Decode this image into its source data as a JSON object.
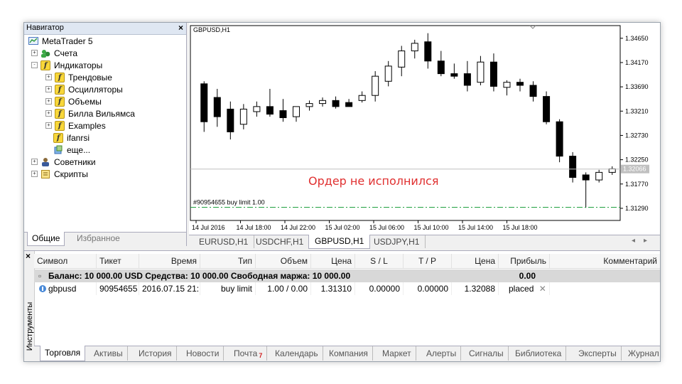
{
  "navigator": {
    "title": "Навигатор",
    "items": [
      {
        "label": "MetaTrader 5",
        "icon": "metatrader-icon",
        "expander": ""
      },
      {
        "label": "Счета",
        "icon": "accounts-icon",
        "expander": "+"
      },
      {
        "label": "Индикаторы",
        "icon": "indicator-folder-icon",
        "expander": "-"
      },
      {
        "label": "Трендовые",
        "icon": "indicator-icon",
        "expander": "+"
      },
      {
        "label": "Осцилляторы",
        "icon": "indicator-icon",
        "expander": "+"
      },
      {
        "label": "Объемы",
        "icon": "indicator-icon",
        "expander": "+"
      },
      {
        "label": "Билла Вильямса",
        "icon": "indicator-icon",
        "expander": "+"
      },
      {
        "label": "Examples",
        "icon": "indicator-icon",
        "expander": "+"
      },
      {
        "label": "ifanrsi",
        "icon": "custom-indicator-icon",
        "expander": ""
      },
      {
        "label": "еще...",
        "icon": "more-icon",
        "expander": ""
      },
      {
        "label": "Советники",
        "icon": "experts-icon",
        "expander": "+"
      },
      {
        "label": "Скрипты",
        "icon": "scripts-icon",
        "expander": "+"
      }
    ],
    "tabs": [
      "Общие",
      "Избранное"
    ]
  },
  "chart": {
    "symbol": "GBPUSD,H1",
    "annotation": "Ордер не исполнился",
    "order_label": "#90954655 buy limit 1.00",
    "current_price": "1.32066",
    "price_ticks": [
      "1.34650",
      "1.34170",
      "1.33690",
      "1.33210",
      "1.32730",
      "1.32250",
      "1.31770",
      "1.31290"
    ],
    "time_ticks": [
      "14 Jul 2016",
      "14 Jul 18:00",
      "14 Jul 22:00",
      "15 Jul 02:00",
      "15 Jul 06:00",
      "15 Jul 10:00",
      "15 Jul 14:00",
      "15 Jul 18:00"
    ]
  },
  "chart_data": {
    "type": "candlestick",
    "symbol": "GBPUSD,H1",
    "ylim": [
      1.3105,
      1.349
    ],
    "current_price": 1.32066,
    "order_price": 1.3131,
    "candles": [
      {
        "o": 1.3375,
        "h": 1.338,
        "l": 1.328,
        "c": 1.33
      },
      {
        "o": 1.3348,
        "h": 1.3365,
        "l": 1.329,
        "c": 1.331
      },
      {
        "o": 1.3325,
        "h": 1.334,
        "l": 1.3265,
        "c": 1.328
      },
      {
        "o": 1.3295,
        "h": 1.3335,
        "l": 1.3285,
        "c": 1.3325
      },
      {
        "o": 1.332,
        "h": 1.334,
        "l": 1.331,
        "c": 1.333
      },
      {
        "o": 1.333,
        "h": 1.3365,
        "l": 1.331,
        "c": 1.3315
      },
      {
        "o": 1.3322,
        "h": 1.3345,
        "l": 1.33,
        "c": 1.3308
      },
      {
        "o": 1.331,
        "h": 1.333,
        "l": 1.33,
        "c": 1.333
      },
      {
        "o": 1.333,
        "h": 1.3342,
        "l": 1.3322,
        "c": 1.3336
      },
      {
        "o": 1.3336,
        "h": 1.3348,
        "l": 1.333,
        "c": 1.3342
      },
      {
        "o": 1.3342,
        "h": 1.335,
        "l": 1.3326,
        "c": 1.333
      },
      {
        "o": 1.3338,
        "h": 1.3345,
        "l": 1.333,
        "c": 1.333
      },
      {
        "o": 1.3342,
        "h": 1.336,
        "l": 1.3338,
        "c": 1.3352
      },
      {
        "o": 1.3352,
        "h": 1.34,
        "l": 1.334,
        "c": 1.339
      },
      {
        "o": 1.338,
        "h": 1.342,
        "l": 1.337,
        "c": 1.341
      },
      {
        "o": 1.3408,
        "h": 1.345,
        "l": 1.339,
        "c": 1.344
      },
      {
        "o": 1.344,
        "h": 1.3462,
        "l": 1.3425,
        "c": 1.3455
      },
      {
        "o": 1.3458,
        "h": 1.3475,
        "l": 1.3405,
        "c": 1.342
      },
      {
        "o": 1.342,
        "h": 1.344,
        "l": 1.339,
        "c": 1.3395
      },
      {
        "o": 1.3395,
        "h": 1.3415,
        "l": 1.3385,
        "c": 1.339
      },
      {
        "o": 1.3395,
        "h": 1.342,
        "l": 1.336,
        "c": 1.3372
      },
      {
        "o": 1.3378,
        "h": 1.343,
        "l": 1.3372,
        "c": 1.3418
      },
      {
        "o": 1.3418,
        "h": 1.3435,
        "l": 1.336,
        "c": 1.337
      },
      {
        "o": 1.3368,
        "h": 1.3382,
        "l": 1.3352,
        "c": 1.3378
      },
      {
        "o": 1.3378,
        "h": 1.3385,
        "l": 1.336,
        "c": 1.3372
      },
      {
        "o": 1.3372,
        "h": 1.338,
        "l": 1.334,
        "c": 1.335
      },
      {
        "o": 1.335,
        "h": 1.336,
        "l": 1.3295,
        "c": 1.33
      },
      {
        "o": 1.33,
        "h": 1.3305,
        "l": 1.322,
        "c": 1.3232
      },
      {
        "o": 1.3232,
        "h": 1.324,
        "l": 1.318,
        "c": 1.319
      },
      {
        "o": 1.3195,
        "h": 1.32,
        "l": 1.313,
        "c": 1.3185
      },
      {
        "o": 1.3185,
        "h": 1.3205,
        "l": 1.318,
        "c": 1.32
      },
      {
        "o": 1.32,
        "h": 1.3212,
        "l": 1.3195,
        "c": 1.3207
      }
    ]
  },
  "chart_tabs": [
    "EURUSD,H1",
    "USDCHF,H1",
    "GBPUSD,H1",
    "USDJPY,H1"
  ],
  "toolbox": {
    "vertical_title": "Инструменты",
    "columns": [
      "Символ",
      "Тикет",
      "Время",
      "Тип",
      "Объем",
      "Цена",
      "S / L",
      "T / P",
      "Цена",
      "Прибыль",
      "Комментарий"
    ],
    "balance_text": "Баланс: 10 000.00 USD  Средства: 10 000.00  Свободная маржа: 10 000.00",
    "balance_profit": "0.00",
    "row": {
      "symbol": "gbpusd",
      "ticket": "90954655",
      "time": "2016.07.15 21:...",
      "type": "buy limit",
      "volume": "1.00 / 0.00",
      "price": "1.31310",
      "sl": "0.00000",
      "tp": "0.00000",
      "current": "1.32088",
      "profit": "placed",
      "close_glyph": "✕"
    },
    "tabs": [
      {
        "label": "Торговля",
        "badge": ""
      },
      {
        "label": "Активы",
        "badge": ""
      },
      {
        "label": "История",
        "badge": ""
      },
      {
        "label": "Новости",
        "badge": ""
      },
      {
        "label": "Почта",
        "badge": "7"
      },
      {
        "label": "Календарь",
        "badge": ""
      },
      {
        "label": "Компания",
        "badge": ""
      },
      {
        "label": "Маркет",
        "badge": ""
      },
      {
        "label": "Алерты",
        "badge": ""
      },
      {
        "label": "Сигналы",
        "badge": ""
      },
      {
        "label": "Библиотека",
        "badge": ""
      },
      {
        "label": "Эксперты",
        "badge": ""
      },
      {
        "label": "Журнал",
        "badge": ""
      }
    ]
  },
  "colors": {
    "annotation": "#e03030",
    "order_line": "#20a040",
    "price_line": "#c0c0c0"
  }
}
